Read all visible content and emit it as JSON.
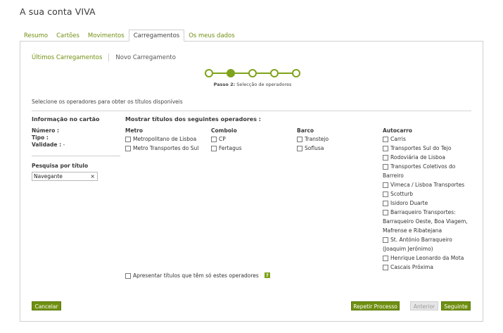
{
  "page": {
    "title": "A sua conta VIVA"
  },
  "tabs": [
    {
      "label": "Resumo"
    },
    {
      "label": "Cartões"
    },
    {
      "label": "Movimentos"
    },
    {
      "label": "Carregamentos",
      "active": true
    },
    {
      "label": "Os meus dados"
    }
  ],
  "subtabs": {
    "last": "Últimos Carregamentos",
    "new": "Novo Carregamento"
  },
  "stepper": {
    "current_step": 2,
    "total_steps": 5,
    "caption_strong": "Passo 2:",
    "caption_text": " Selecção de operadores"
  },
  "instructions": "Selecione os operadores para obter os títulos disponíveis",
  "card_info": {
    "title": "Informação no cartão",
    "numero_label": "Número :",
    "numero_value": "",
    "tipo_label": "Tipo :",
    "tipo_value": "",
    "validade_label": "Validade :",
    "validade_value": " -"
  },
  "search": {
    "label": "Pesquisa por título",
    "value": "Navegante",
    "clear_icon": "×"
  },
  "operators": {
    "title": "Mostrar títulos dos seguintes operadores :",
    "metro": {
      "label": "Metro",
      "items": [
        "Metropolitano de Lisboa",
        "Metro Transportes do Sul"
      ]
    },
    "comboio": {
      "label": "Comboio",
      "items": [
        "CP",
        "Fertagus"
      ]
    },
    "barco": {
      "label": "Barco",
      "items": [
        "Transtejo",
        "Soflusa"
      ]
    },
    "autocarro": {
      "label": "Autocarro",
      "items": [
        "Carris",
        "Transportes Sul do Tejo",
        "Rodoviária de Lisboa",
        "Transportes Coletivos do",
        "Barreiro",
        "Vimeca / Lisboa Transportes",
        "Scotturb",
        "Isidoro Duarte",
        "Barraqueiro Transportes:",
        "Barraqueiro Oeste, Boa Viagem,",
        "Mafrense e Ribatejana",
        "St. António Barraqueiro",
        "(Joaquim Jerónimo)",
        "Henrique Leonardo da Mota",
        "Cascais Próxima"
      ]
    }
  },
  "only_these_label": "Apresentar títulos que têm só estes operadores",
  "help_icon": "?",
  "buttons": {
    "cancel": "Cancelar",
    "repeat": "Repetir Processo",
    "previous": "Anterior",
    "next": "Seguinte"
  },
  "colors": {
    "accent": "#6f8f10",
    "step": "#7fa31a"
  }
}
